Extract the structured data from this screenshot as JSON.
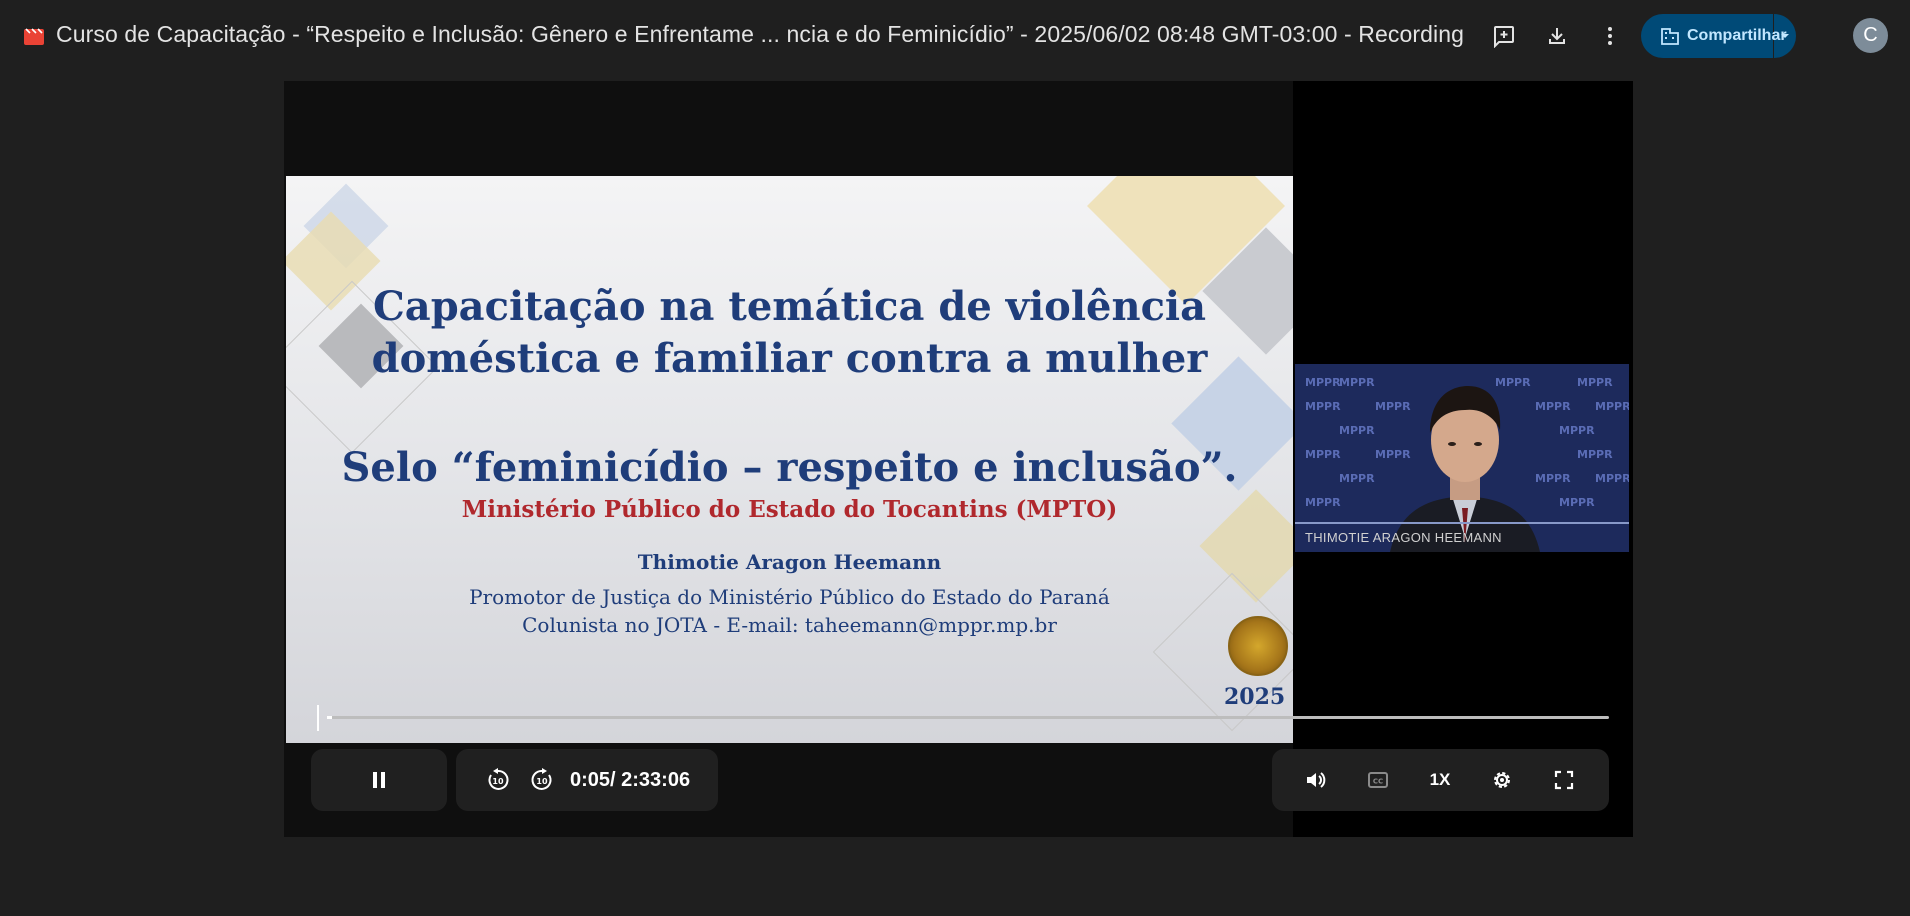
{
  "header": {
    "title": "Curso de Capacitação - “Respeito e Inclusão: Gênero e Enfrentame ... ncia e do Feminicídio” - 2025/06/02 08:48 GMT-03:00 - Recording",
    "share_label": "Compartilhar",
    "avatar_initial": "C",
    "icons": [
      "video-file-icon",
      "add-comment-icon",
      "download-icon",
      "more-vert-icon",
      "domain-icon",
      "caret-down-icon"
    ]
  },
  "slide": {
    "line1": "Capacitação na temática de violência",
    "line2": "doméstica e familiar contra a mulher",
    "line3": "Selo “feminicídio – respeito e inclusão”.",
    "line4": "Ministério Público do Estado do Tocantins (MPTO)",
    "line5": "Thimotie Aragon Heemann",
    "line6": "Promotor de Justiça do Ministério Público do Estado do Paraná",
    "line7": "Colunista no JOTA - E-mail: taheemann@mppr.mp.br",
    "year": "2025"
  },
  "camera": {
    "participant_name": "THIMOTIE ARAGON HEEMANN",
    "background_text": "MPPR"
  },
  "player": {
    "current_time": "0:05",
    "duration": "/ 2:33:06",
    "progress_fraction": 0.004,
    "speed": "1X",
    "icons": [
      "pause-icon",
      "rewind-10-icon",
      "forward-10-icon",
      "volume-icon",
      "captions-icon",
      "settings-icon",
      "fullscreen-icon"
    ]
  },
  "colors": {
    "share_bg": "#004a77",
    "share_text": "#c2e7ff",
    "bg": "#1f1f1f",
    "slide_title": "#1f3d7a",
    "slide_red": "#b0282d"
  }
}
